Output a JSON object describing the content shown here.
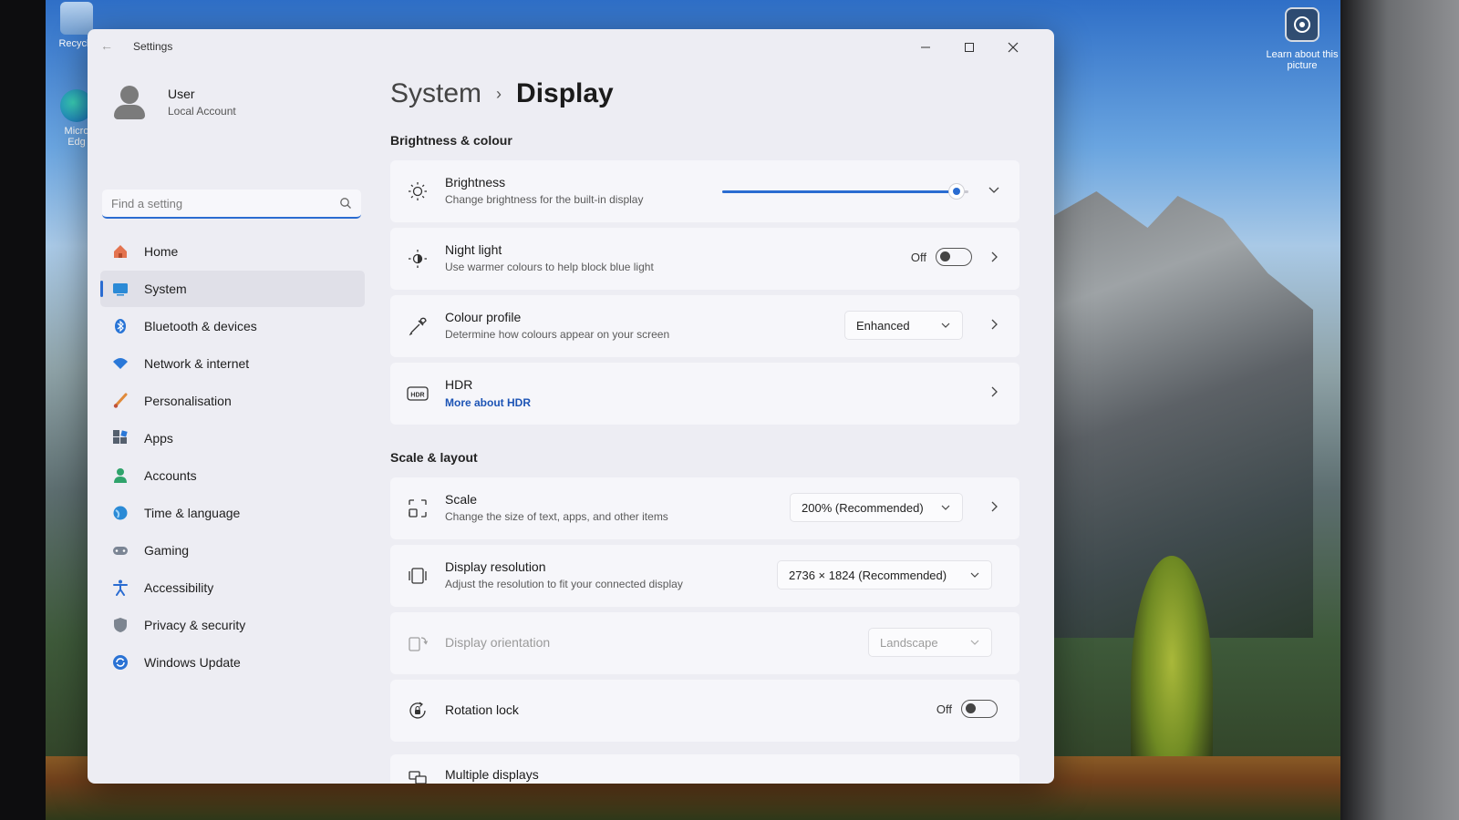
{
  "desktop": {
    "icons": [
      {
        "label": "Recycle"
      },
      {
        "label": "Micro Edg"
      }
    ],
    "learn_label": "Learn about this picture"
  },
  "window": {
    "title": "Settings"
  },
  "profile": {
    "name": "User",
    "account": "Local Account"
  },
  "search": {
    "placeholder": "Find a setting"
  },
  "nav": {
    "items": [
      {
        "label": "Home",
        "icon": "home-icon"
      },
      {
        "label": "System",
        "icon": "system-icon",
        "active": true
      },
      {
        "label": "Bluetooth & devices",
        "icon": "bluetooth-icon"
      },
      {
        "label": "Network & internet",
        "icon": "wifi-icon"
      },
      {
        "label": "Personalisation",
        "icon": "brush-icon"
      },
      {
        "label": "Apps",
        "icon": "apps-icon"
      },
      {
        "label": "Accounts",
        "icon": "accounts-icon"
      },
      {
        "label": "Time & language",
        "icon": "globe-icon"
      },
      {
        "label": "Gaming",
        "icon": "gamepad-icon"
      },
      {
        "label": "Accessibility",
        "icon": "accessibility-icon"
      },
      {
        "label": "Privacy & security",
        "icon": "shield-icon"
      },
      {
        "label": "Windows Update",
        "icon": "update-icon"
      }
    ]
  },
  "breadcrumb": {
    "parent": "System",
    "separator": "›",
    "current": "Display"
  },
  "sections": {
    "brightness_colour": "Brightness & colour",
    "scale_layout": "Scale & layout"
  },
  "brightness": {
    "title": "Brightness",
    "subtitle": "Change brightness for the built-in display",
    "level": 0.95
  },
  "night_light": {
    "title": "Night light",
    "subtitle": "Use warmer colours to help block blue light",
    "state": "Off"
  },
  "colour_profile": {
    "title": "Colour profile",
    "subtitle": "Determine how colours appear on your screen",
    "value": "Enhanced"
  },
  "hdr": {
    "title": "HDR",
    "link": "More about HDR",
    "badge": "HDR"
  },
  "scale": {
    "title": "Scale",
    "subtitle": "Change the size of text, apps, and other items",
    "value": "200% (Recommended)"
  },
  "resolution": {
    "title": "Display resolution",
    "subtitle": "Adjust the resolution to fit your connected display",
    "value": "2736 × 1824 (Recommended)"
  },
  "orientation": {
    "title": "Display orientation",
    "value": "Landscape"
  },
  "rotation_lock": {
    "title": "Rotation lock",
    "state": "Off"
  },
  "multiple_displays": {
    "title": "Multiple displays"
  },
  "colors": {
    "accent": "#2a6cd1",
    "link": "#1d54b5",
    "window_bg": "#ededf3",
    "card_bg": "#f6f6fa"
  }
}
